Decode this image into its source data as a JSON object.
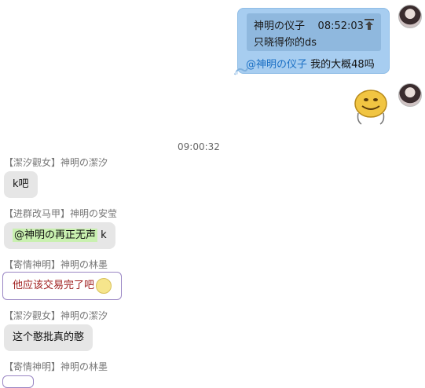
{
  "own_message": {
    "quote_sender": "神明の仪子",
    "quote_time": "08:52:03",
    "quote_text": "只晓得你的ds",
    "mention": "@神明の仪子",
    "text": "我的大概48吗"
  },
  "timestamp": "09:00:32",
  "messages": [
    {
      "sender": "【潔汐觀女】神明の潔汐",
      "text": "k吧"
    },
    {
      "sender": "【进群改马甲】神明の安莹",
      "mention": "@神明の再正无声",
      "text": "k"
    },
    {
      "sender": "【寄情神明】神明の林墨",
      "text": "他应该交易完了吧"
    },
    {
      "sender": "【潔汐觀女】神明の潔汐",
      "text": "这个憨批真的憨"
    },
    {
      "sender": "【寄情神明】神明の林墨"
    }
  ],
  "icons": {
    "avatar": "avatar-icon",
    "jump_to_quote": "arrow-up-icon",
    "sticker": "smiley-sticker",
    "emoji": "smiley-emoji-icon"
  },
  "colors": {
    "own_bubble": "#a7cdf0",
    "quote_block": "#8fb8de",
    "mention": "#1a6fc4",
    "other_bubble": "#e6e6e6",
    "at_chip": "#c9f0b0",
    "fancy_text": "#a02020"
  }
}
